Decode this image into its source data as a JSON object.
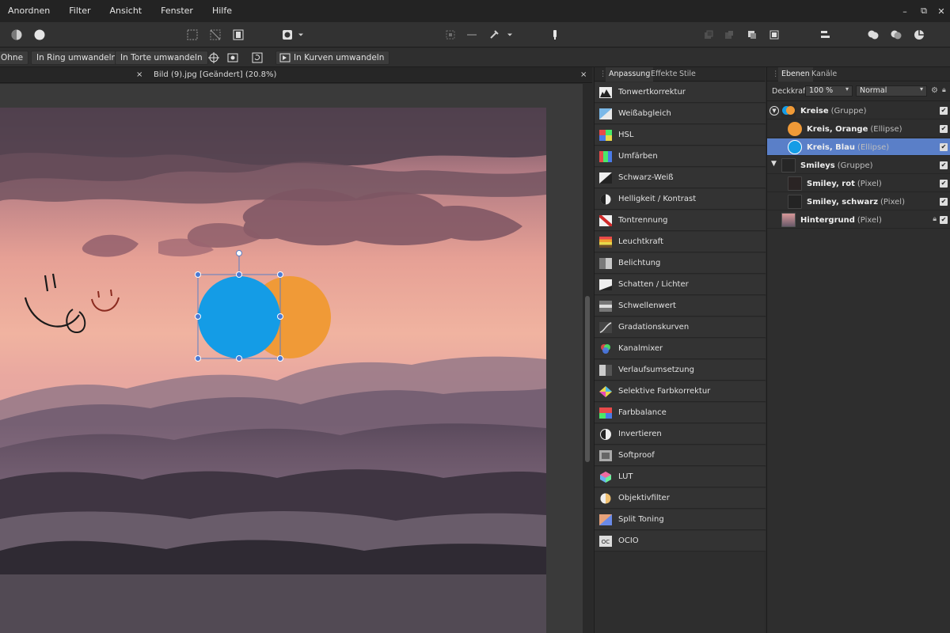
{
  "menu": [
    "Anordnen",
    "Filter",
    "Ansicht",
    "Fenster",
    "Hilfe"
  ],
  "window_controls": {
    "minimize": "–",
    "restore": "⧉",
    "close": "✕"
  },
  "context_bar": {
    "ohne": "Ohne",
    "ring": "In Ring umwandeln",
    "torte": "In Torte umwandeln",
    "kurven": "In Kurven umwandeln"
  },
  "doc_tab": {
    "title": "Bild (9).jpg [Geändert] (20.8%)",
    "close": "×"
  },
  "adjustment_panel": {
    "tabs": [
      "Anpassung",
      "Effekte",
      "Stile"
    ],
    "items": [
      {
        "label": "Tonwertkorrektur",
        "icon": "levels-icon"
      },
      {
        "label": "Weißabgleich",
        "icon": "white-balance-icon"
      },
      {
        "label": "HSL",
        "icon": "hsl-icon"
      },
      {
        "label": "Umfärben",
        "icon": "recolor-icon"
      },
      {
        "label": "Schwarz-Weiß",
        "icon": "black-white-icon"
      },
      {
        "label": "Helligkeit / Kontrast",
        "icon": "brightness-contrast-icon"
      },
      {
        "label": "Tontrennung",
        "icon": "posterize-icon"
      },
      {
        "label": "Leuchtkraft",
        "icon": "vibrance-icon"
      },
      {
        "label": "Belichtung",
        "icon": "exposure-icon"
      },
      {
        "label": "Schatten / Lichter",
        "icon": "shadows-highlights-icon"
      },
      {
        "label": "Schwellenwert",
        "icon": "threshold-icon"
      },
      {
        "label": "Gradationskurven",
        "icon": "curves-icon"
      },
      {
        "label": "Kanalmixer",
        "icon": "channel-mixer-icon"
      },
      {
        "label": "Verlaufsumsetzung",
        "icon": "gradient-map-icon"
      },
      {
        "label": "Selektive Farbkorrektur",
        "icon": "selective-color-icon"
      },
      {
        "label": "Farbbalance",
        "icon": "color-balance-icon"
      },
      {
        "label": "Invertieren",
        "icon": "invert-icon"
      },
      {
        "label": "Softproof",
        "icon": "soft-proof-icon"
      },
      {
        "label": "LUT",
        "icon": "lut-icon"
      },
      {
        "label": "Objektivfilter",
        "icon": "lens-filter-icon"
      },
      {
        "label": "Split Toning",
        "icon": "split-toning-icon"
      },
      {
        "label": "OCIO",
        "icon": "ocio-icon"
      }
    ]
  },
  "layers_panel": {
    "tabs": [
      "Ebenen",
      "Kanäle"
    ],
    "opacity_label": "Deckkraft:",
    "opacity_value": "100 %",
    "blend_mode": "Normal",
    "layers": [
      {
        "name": "Kreise",
        "type": "(Gruppe)",
        "indent": 0,
        "expanded": true,
        "selected": false
      },
      {
        "name": "Kreis, Orange",
        "type": "(Ellipse)",
        "indent": 1,
        "selected": false
      },
      {
        "name": "Kreis, Blau",
        "type": "(Ellipse)",
        "indent": 1,
        "selected": true
      },
      {
        "name": "Smileys",
        "type": "(Gruppe)",
        "indent": 0,
        "expanded": true,
        "selected": false
      },
      {
        "name": "Smiley, rot",
        "type": "(Pixel)",
        "indent": 1,
        "selected": false
      },
      {
        "name": "Smiley, schwarz",
        "type": "(Pixel)",
        "indent": 1,
        "selected": false
      },
      {
        "name": "Hintergrund",
        "type": "(Pixel)",
        "indent": 0,
        "selected": false,
        "locked": true
      }
    ]
  },
  "colors": {
    "blue_circle": "#149ce6",
    "orange_circle": "#f09a37",
    "selection": "#5a7fc8",
    "red_smiley": "#8a2a1f"
  }
}
